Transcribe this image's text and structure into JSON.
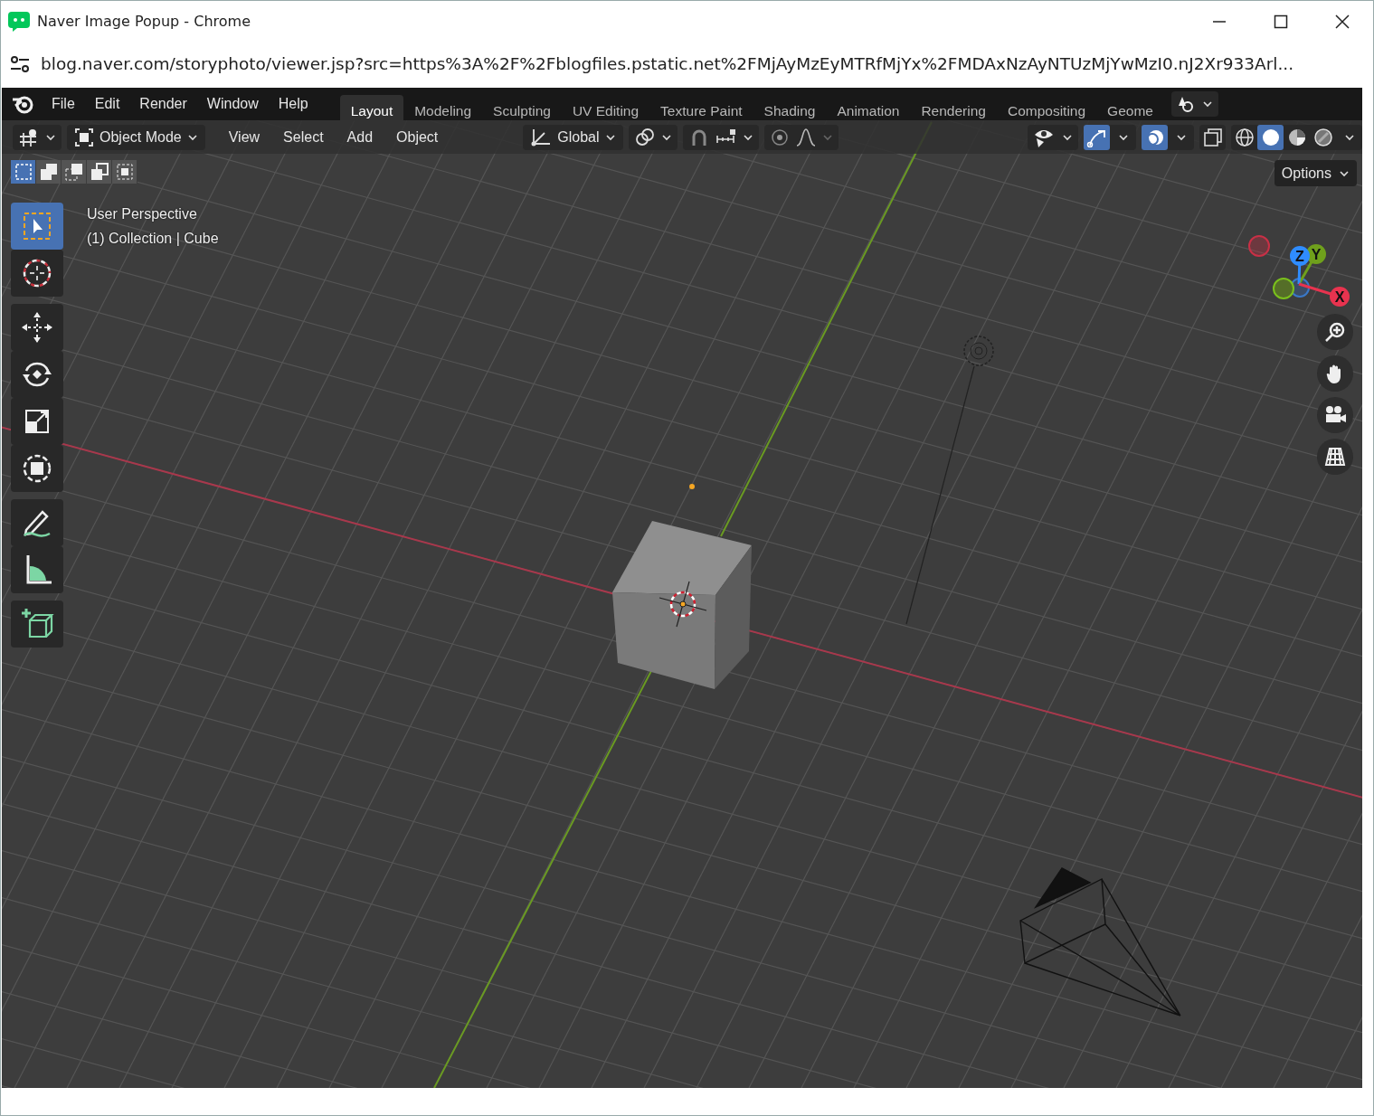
{
  "window": {
    "title": "Naver Image Popup - Chrome"
  },
  "address_bar": {
    "url": "blog.naver.com/storyphoto/viewer.jsp?src=https%3A%2F%2Fblogfiles.pstatic.net%2FMjAyMzEyMTRfMjYx%2FMDAxNzAyNTUzMjYwMzI0.nJ2Xr933Arl..."
  },
  "menu": [
    "File",
    "Edit",
    "Render",
    "Window",
    "Help"
  ],
  "workspaces": [
    {
      "label": "Layout",
      "selected": true
    },
    {
      "label": "Modeling",
      "selected": false
    },
    {
      "label": "Sculpting",
      "selected": false
    },
    {
      "label": "UV Editing",
      "selected": false
    },
    {
      "label": "Texture Paint",
      "selected": false
    },
    {
      "label": "Shading",
      "selected": false
    },
    {
      "label": "Animation",
      "selected": false
    },
    {
      "label": "Rendering",
      "selected": false
    },
    {
      "label": "Compositing",
      "selected": false
    },
    {
      "label": "Geome",
      "selected": false
    }
  ],
  "header": {
    "mode": "Object Mode",
    "menus": [
      "View",
      "Select",
      "Add",
      "Object"
    ],
    "orientation": "Global"
  },
  "header_toggles": [
    {
      "kind": "gizmo",
      "selected": true
    },
    {
      "kind": "overlay",
      "selected": true
    },
    {
      "kind": "xray",
      "selected": false
    }
  ],
  "shading_modes": [
    {
      "kind": "wireframe",
      "selected": false
    },
    {
      "kind": "solid",
      "selected": true
    },
    {
      "kind": "material",
      "selected": false
    },
    {
      "kind": "rendered",
      "selected": false
    }
  ],
  "select_modes": [
    {
      "kind": "new",
      "selected": true
    },
    {
      "kind": "extend",
      "selected": false
    },
    {
      "kind": "subtract",
      "selected": false
    },
    {
      "kind": "invert",
      "selected": false
    },
    {
      "kind": "intersect",
      "selected": false
    }
  ],
  "options_label": "Options",
  "viewport": {
    "view_name": "User Perspective",
    "collection": "(1) Collection | Cube"
  },
  "tools": [
    {
      "kind": "select",
      "selected": true
    },
    {
      "kind": "cursor",
      "selected": false
    },
    {
      "kind": "move",
      "selected": false
    },
    {
      "kind": "rotate",
      "selected": false
    },
    {
      "kind": "scale",
      "selected": false
    },
    {
      "kind": "transform",
      "selected": false
    },
    {
      "kind": "annotate",
      "selected": false
    },
    {
      "kind": "measure",
      "selected": false
    },
    {
      "kind": "add-cube",
      "selected": false
    }
  ],
  "gizmo_axes": [
    {
      "label": "Z",
      "color": "#2f8cff"
    },
    {
      "label": "Y",
      "color": "#6fa01c"
    },
    {
      "label": "X",
      "color": "#e8334f"
    }
  ]
}
